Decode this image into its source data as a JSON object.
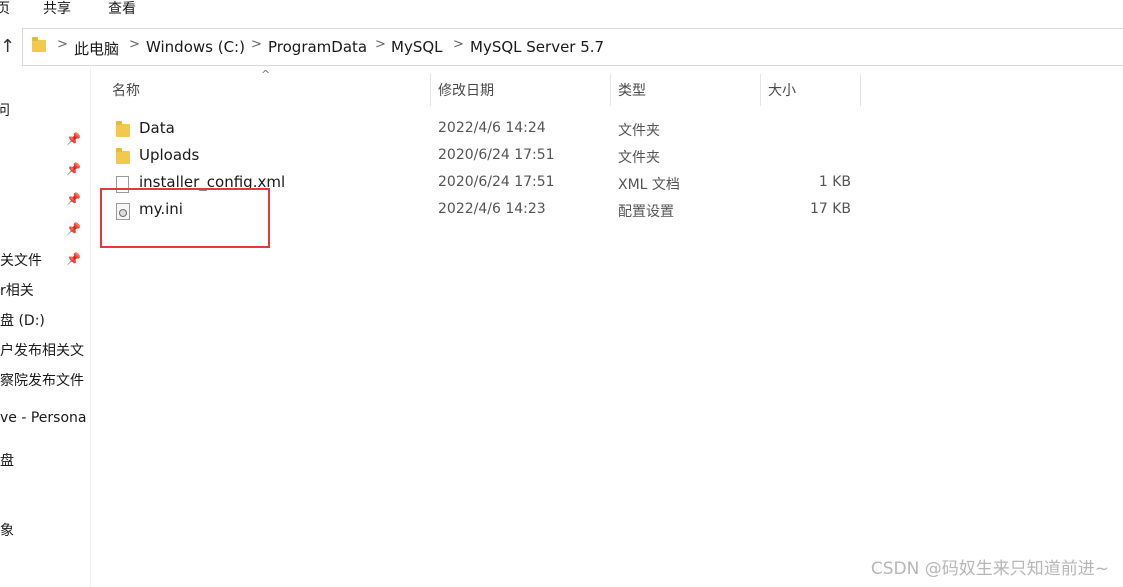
{
  "ribbon": {
    "tabs": [
      {
        "label": "页"
      },
      {
        "label": "共享"
      },
      {
        "label": "查看"
      }
    ]
  },
  "address_bar": {
    "up_symbol": "↑",
    "separator": ">",
    "crumbs": [
      {
        "label": "此电脑"
      },
      {
        "label": "Windows (C:)"
      },
      {
        "label": "ProgramData"
      },
      {
        "label": "MySQL"
      },
      {
        "label": "MySQL Server 5.7"
      }
    ]
  },
  "nav_pane": {
    "pin_symbol": "📌",
    "items": [
      {
        "label": "问"
      },
      {
        "label": "关文件"
      },
      {
        "label": "r相关"
      },
      {
        "label": "盘 (D:)"
      },
      {
        "label": "户发布相关文"
      },
      {
        "label": "察院发布文件"
      },
      {
        "label": "ve - Persona"
      },
      {
        "label": "盘"
      },
      {
        "label": "象"
      }
    ]
  },
  "columns": {
    "sort_arrow": "^",
    "name": "名称",
    "date": "修改日期",
    "type": "类型",
    "size": "大小"
  },
  "files": [
    {
      "name": "Data",
      "date": "2022/4/6 14:24",
      "type": "文件夹",
      "size": "",
      "icon": "folder-icon"
    },
    {
      "name": "Uploads",
      "date": "2020/6/24 17:51",
      "type": "文件夹",
      "size": "",
      "icon": "folder-icon"
    },
    {
      "name": "installer_config.xml",
      "date": "2020/6/24 17:51",
      "type": "XML 文档",
      "size": "1 KB",
      "icon": "xml-document-icon"
    },
    {
      "name": "my.ini",
      "date": "2022/4/6 14:23",
      "type": "配置设置",
      "size": "17 KB",
      "icon": "config-file-icon"
    }
  ],
  "highlight_color": "#e03a3a",
  "watermark": "CSDN @码奴生来只知道前进~"
}
